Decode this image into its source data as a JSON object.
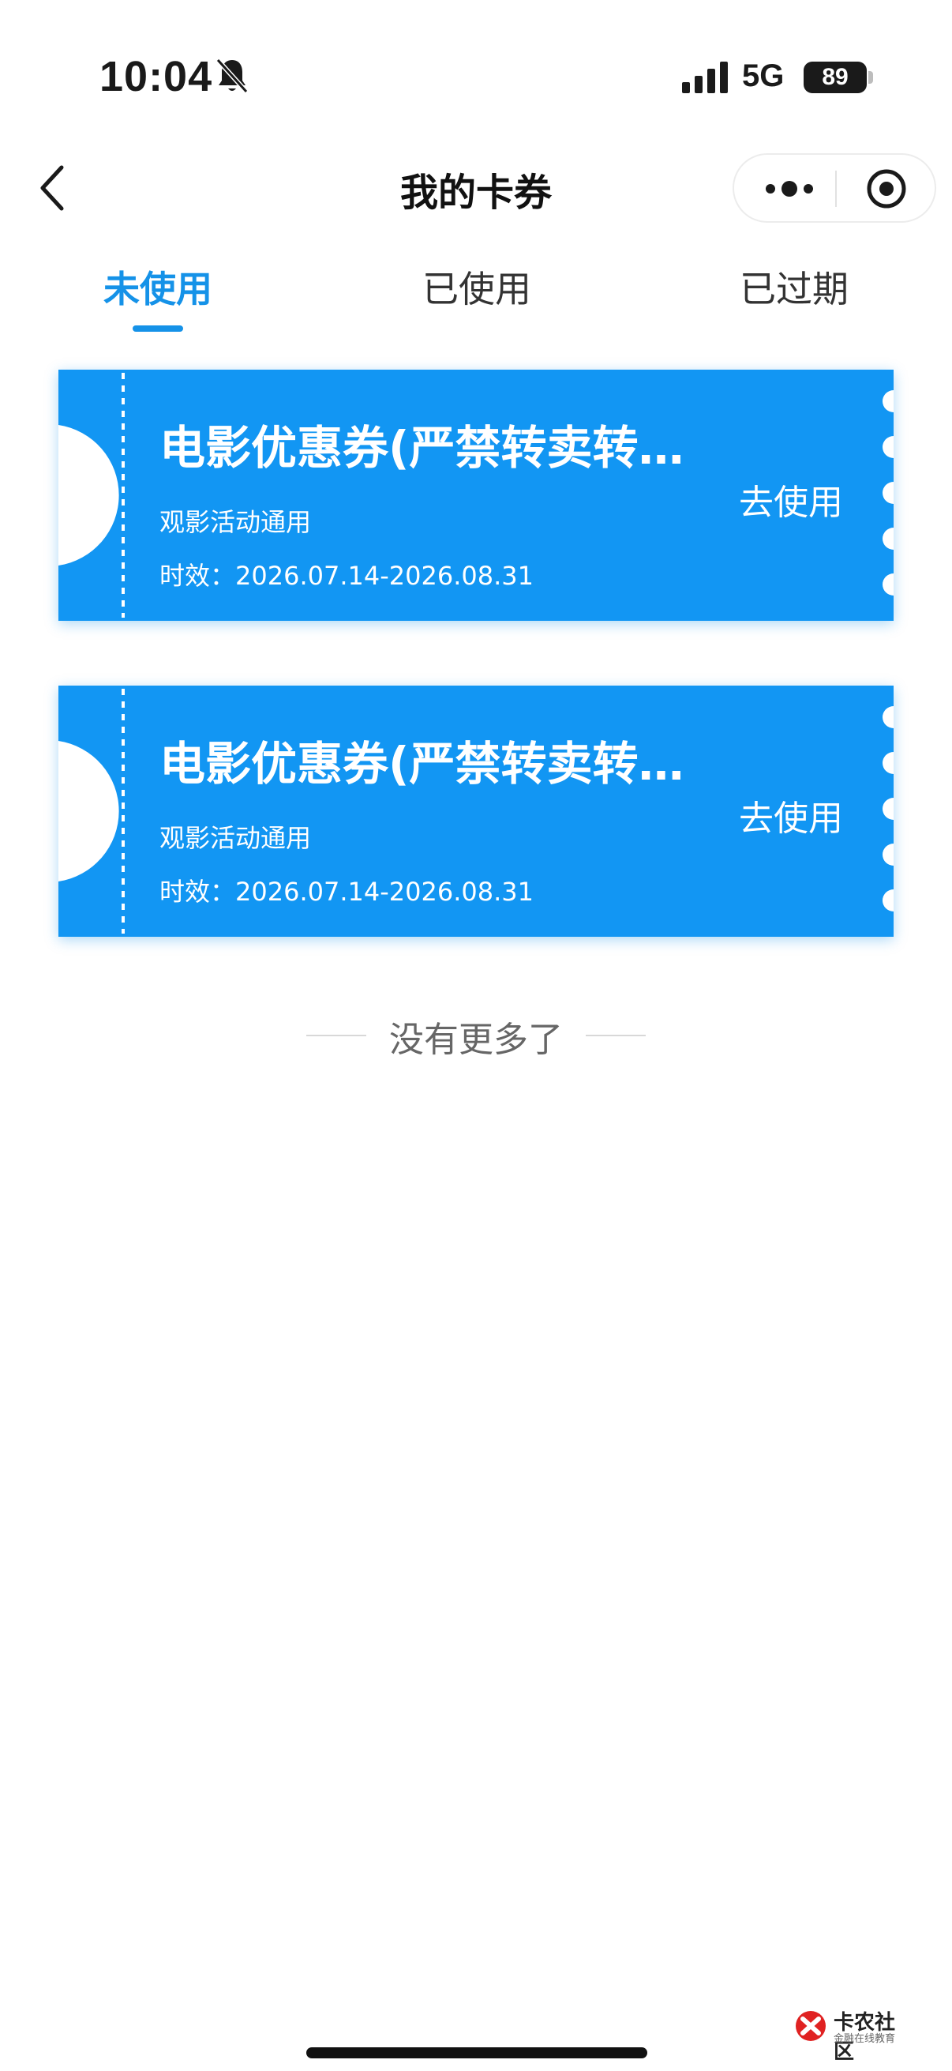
{
  "status_bar": {
    "time": "10:04",
    "network": "5G",
    "battery": "89",
    "icons": [
      "bell-slash-icon",
      "signal-icon",
      "battery-icon"
    ]
  },
  "nav": {
    "title": "我的卡券",
    "icons": [
      "chevron-left-icon",
      "more-dots-icon",
      "target-icon"
    ]
  },
  "tabs": [
    {
      "label": "未使用",
      "active": true
    },
    {
      "label": "已使用",
      "active": false
    },
    {
      "label": "已过期",
      "active": false
    }
  ],
  "coupons": [
    {
      "title": "电影优惠券(严禁转卖转…",
      "subtitle": "观影活动通用",
      "validity": "时效：2026.07.14-2026.08.31",
      "action": "去使用"
    },
    {
      "title": "电影优惠券(严禁转卖转…",
      "subtitle": "观影活动通用",
      "validity": "时效：2026.07.14-2026.08.31",
      "action": "去使用"
    }
  ],
  "footer": {
    "no_more": "没有更多了"
  },
  "watermark": {
    "title": "卡农社区",
    "subtitle": "金融在线教育"
  },
  "colors": {
    "accent": "#1592e8",
    "coupon": "#1296f3",
    "text": "#1a1a1a"
  }
}
